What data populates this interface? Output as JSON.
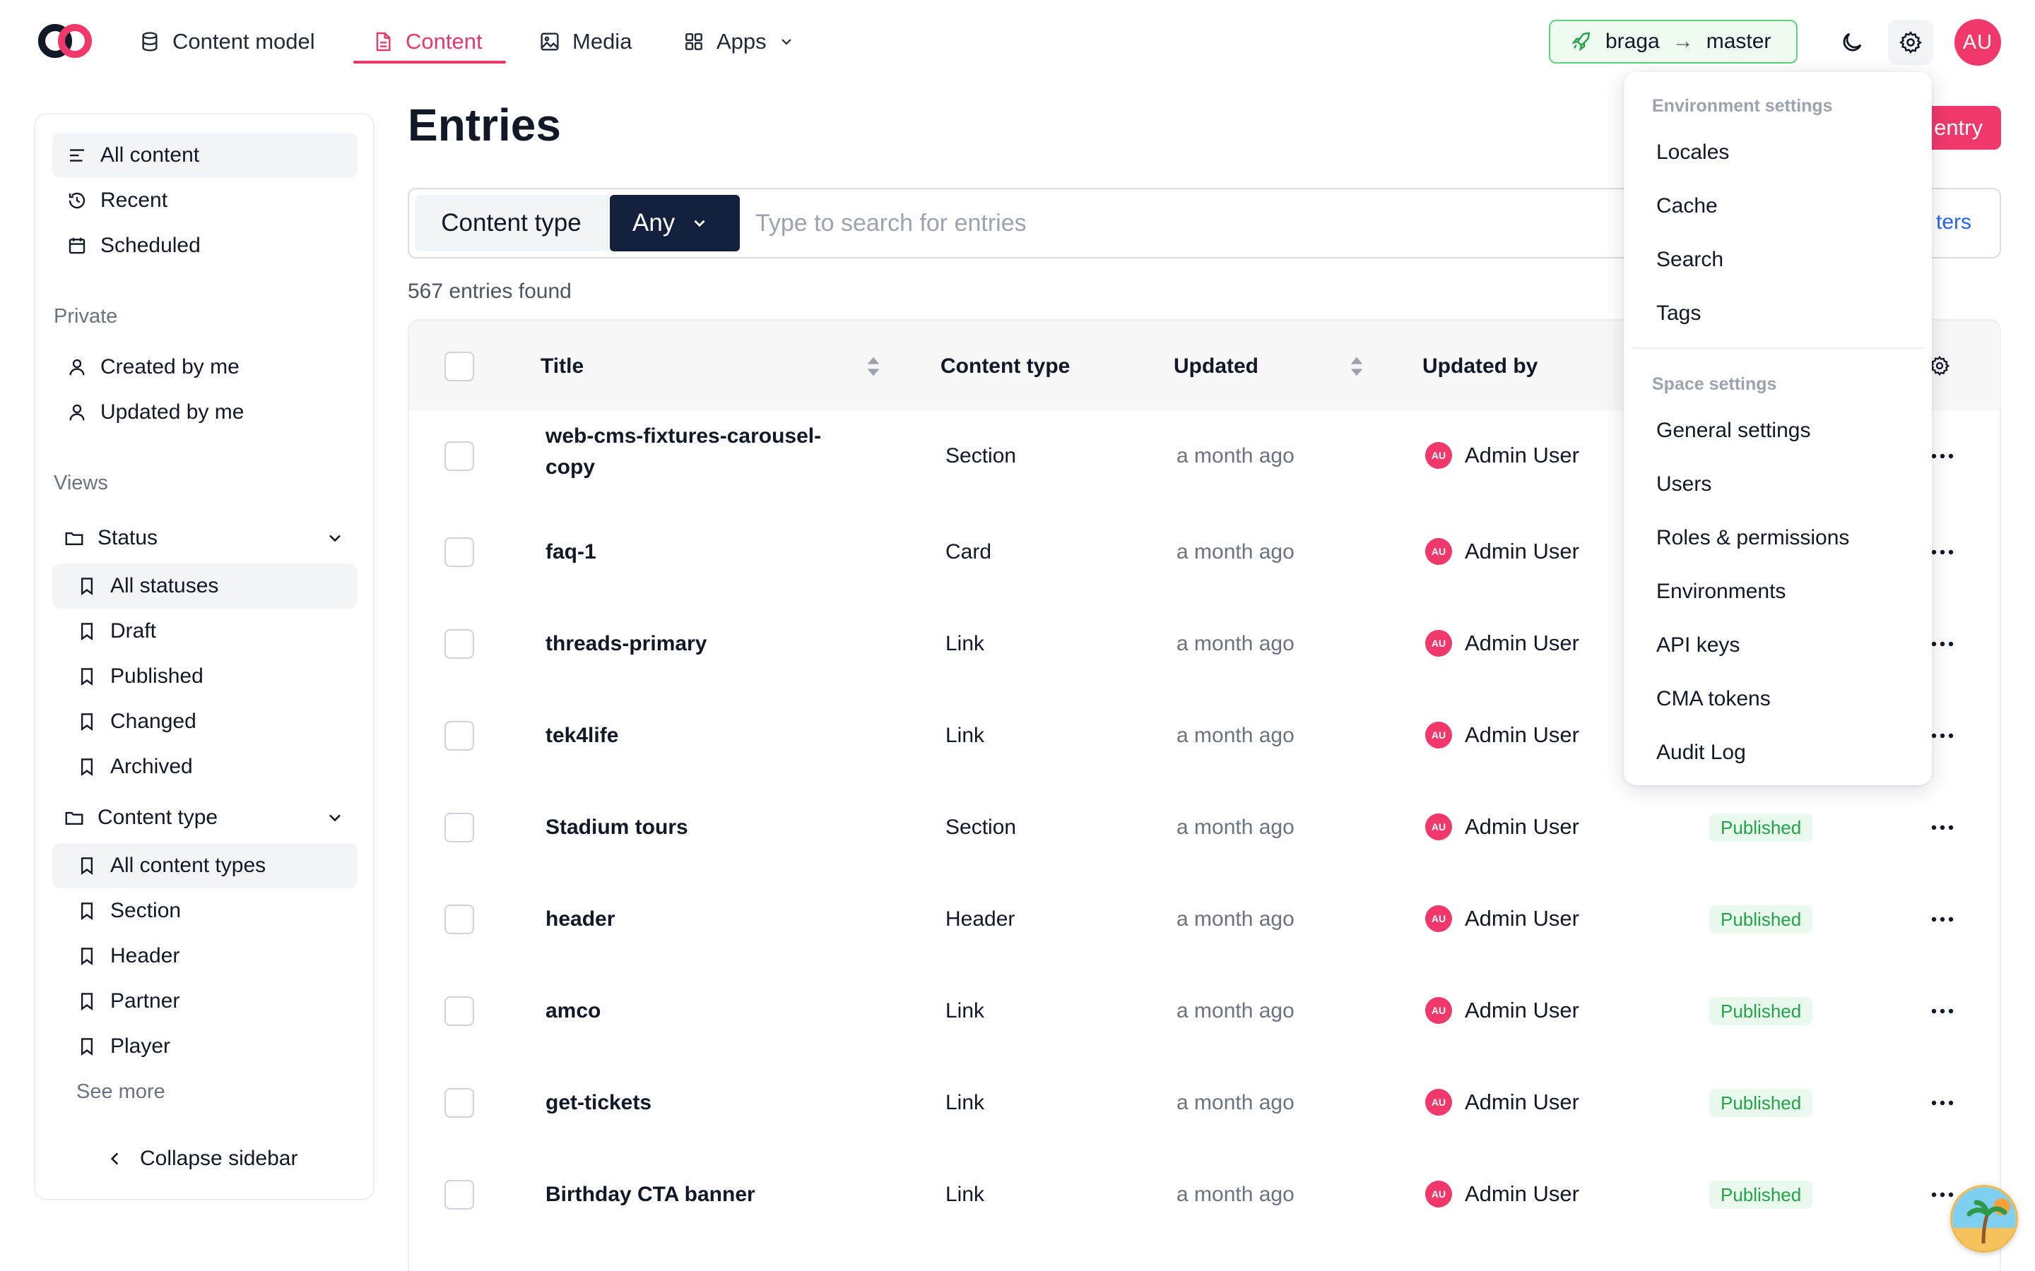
{
  "nav": {
    "content_model": "Content model",
    "content": "Content",
    "media": "Media",
    "apps": "Apps"
  },
  "environment": {
    "space": "braga",
    "arrow": "→",
    "env": "master"
  },
  "user": {
    "initials": "AU"
  },
  "sidebar": {
    "all_content": "All content",
    "recent": "Recent",
    "scheduled": "Scheduled",
    "private_heading": "Private",
    "created_by_me": "Created by me",
    "updated_by_me": "Updated by me",
    "views_heading": "Views",
    "status_group": "Status",
    "statuses": [
      "All statuses",
      "Draft",
      "Published",
      "Changed",
      "Archived"
    ],
    "content_type_group": "Content type",
    "content_types": [
      "All content types",
      "Section",
      "Header",
      "Partner",
      "Player"
    ],
    "see_more": "See more",
    "collapse": "Collapse sidebar"
  },
  "page": {
    "title": "Entries",
    "create_button": "entry",
    "search_placeholder": "Type to search for entries",
    "content_type_label": "Content type",
    "content_type_value": "Any",
    "filters_link": "ters",
    "found": "567 entries found"
  },
  "table": {
    "headers": {
      "title": "Title",
      "content_type": "Content type",
      "updated": "Updated",
      "updated_by": "Updated by"
    },
    "rows": [
      {
        "title": "web-cms-fixtures-carousel-copy",
        "content_type": "Section",
        "updated": "a month ago",
        "updated_by": "Admin User",
        "status": ""
      },
      {
        "title": "faq-1",
        "content_type": "Card",
        "updated": "a month ago",
        "updated_by": "Admin User",
        "status": ""
      },
      {
        "title": "threads-primary",
        "content_type": "Link",
        "updated": "a month ago",
        "updated_by": "Admin User",
        "status": ""
      },
      {
        "title": "tek4life",
        "content_type": "Link",
        "updated": "a month ago",
        "updated_by": "Admin User",
        "status": ""
      },
      {
        "title": "Stadium tours",
        "content_type": "Section",
        "updated": "a month ago",
        "updated_by": "Admin User",
        "status": "Published"
      },
      {
        "title": "header",
        "content_type": "Header",
        "updated": "a month ago",
        "updated_by": "Admin User",
        "status": "Published"
      },
      {
        "title": "amco",
        "content_type": "Link",
        "updated": "a month ago",
        "updated_by": "Admin User",
        "status": "Published"
      },
      {
        "title": "get-tickets",
        "content_type": "Link",
        "updated": "a month ago",
        "updated_by": "Admin User",
        "status": "Published"
      },
      {
        "title": "Birthday CTA banner",
        "content_type": "Link",
        "updated": "a month ago",
        "updated_by": "Admin User",
        "status": "Published"
      }
    ]
  },
  "settings_menu": {
    "environment_heading": "Environment settings",
    "environment_items": [
      "Locales",
      "Cache",
      "Search",
      "Tags"
    ],
    "space_heading": "Space settings",
    "space_items": [
      "General settings",
      "Users",
      "Roles & permissions",
      "Environments",
      "API keys",
      "CMA tokens",
      "Audit Log"
    ]
  },
  "colors": {
    "accent": "#f0386b",
    "nav_active": "#e8386b",
    "env_border": "#5ed27f",
    "any_button": "#13213f",
    "published_bg": "#e9f9ee",
    "published_text": "#22a447"
  },
  "icons": [
    "logo-icon",
    "database-icon",
    "document-icon",
    "image-icon",
    "grid-icon",
    "chevron-down-icon",
    "rocket-icon",
    "moon-icon",
    "gear-icon",
    "list-icon",
    "history-icon",
    "calendar-icon",
    "user-icon",
    "folder-icon",
    "bookmark-icon",
    "chevron-left-icon",
    "sort-icon",
    "more-horizontal-icon"
  ]
}
